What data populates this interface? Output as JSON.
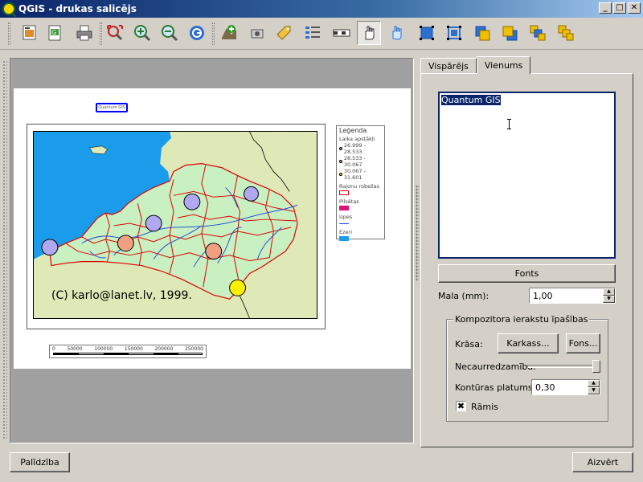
{
  "window": {
    "title": "QGIS - drukas salicējs"
  },
  "toolbar": {
    "buttons": [
      "add-map",
      "add-text-label",
      "print",
      "zoom-full",
      "zoom-in",
      "zoom-out",
      "refresh",
      "add-vector-legend",
      "add-image",
      "add-label",
      "add-legend",
      "add-scalebar",
      "select-move",
      "pan",
      "group",
      "ungroup",
      "raise",
      "lower",
      "move-to-top",
      "move-to-bottom"
    ]
  },
  "composer": {
    "paper_label": "Quantum GIS",
    "copyright": "(C) karlo@lanet.lv, 1999.",
    "legend": {
      "title": "Leģenda",
      "layer1": "Laika apstākļi",
      "range1": "26.999 - 28.533",
      "range2": "28.533 - 30.067",
      "range3": "30.067 - 31.601",
      "layer2": "Rajonu robežas",
      "layer3": "Pilsētas",
      "layer4": "Upes",
      "layer5": "Ezeri"
    },
    "scalebar": [
      "0",
      "50000",
      "100000",
      "150000",
      "200000",
      "250000"
    ]
  },
  "tabs": [
    "Vispārējs",
    "Vienums"
  ],
  "item_panel": {
    "label_text": "Quantum GIS",
    "fonts_button": "Fonts",
    "margin_label": "Mala (mm):",
    "margin_value": "1,00",
    "group_title": "Kompozitora ierakstu īpašības",
    "color_label": "Krāsa:",
    "frame_button": "Karkass...",
    "fill_button": "Fons...",
    "opacity_label": "Necaurredzamība:",
    "opacity_value": 1.0,
    "outline_label": "Kontūras platums",
    "outline_value": "0,30",
    "frame_checkbox": "Rāmis",
    "frame_checked": "✖"
  },
  "footer": {
    "help_button": "Palīdzība",
    "close_button": "Aizvērt"
  },
  "colors": {
    "selection": "#0a246a",
    "face": "#d4d0c8"
  }
}
